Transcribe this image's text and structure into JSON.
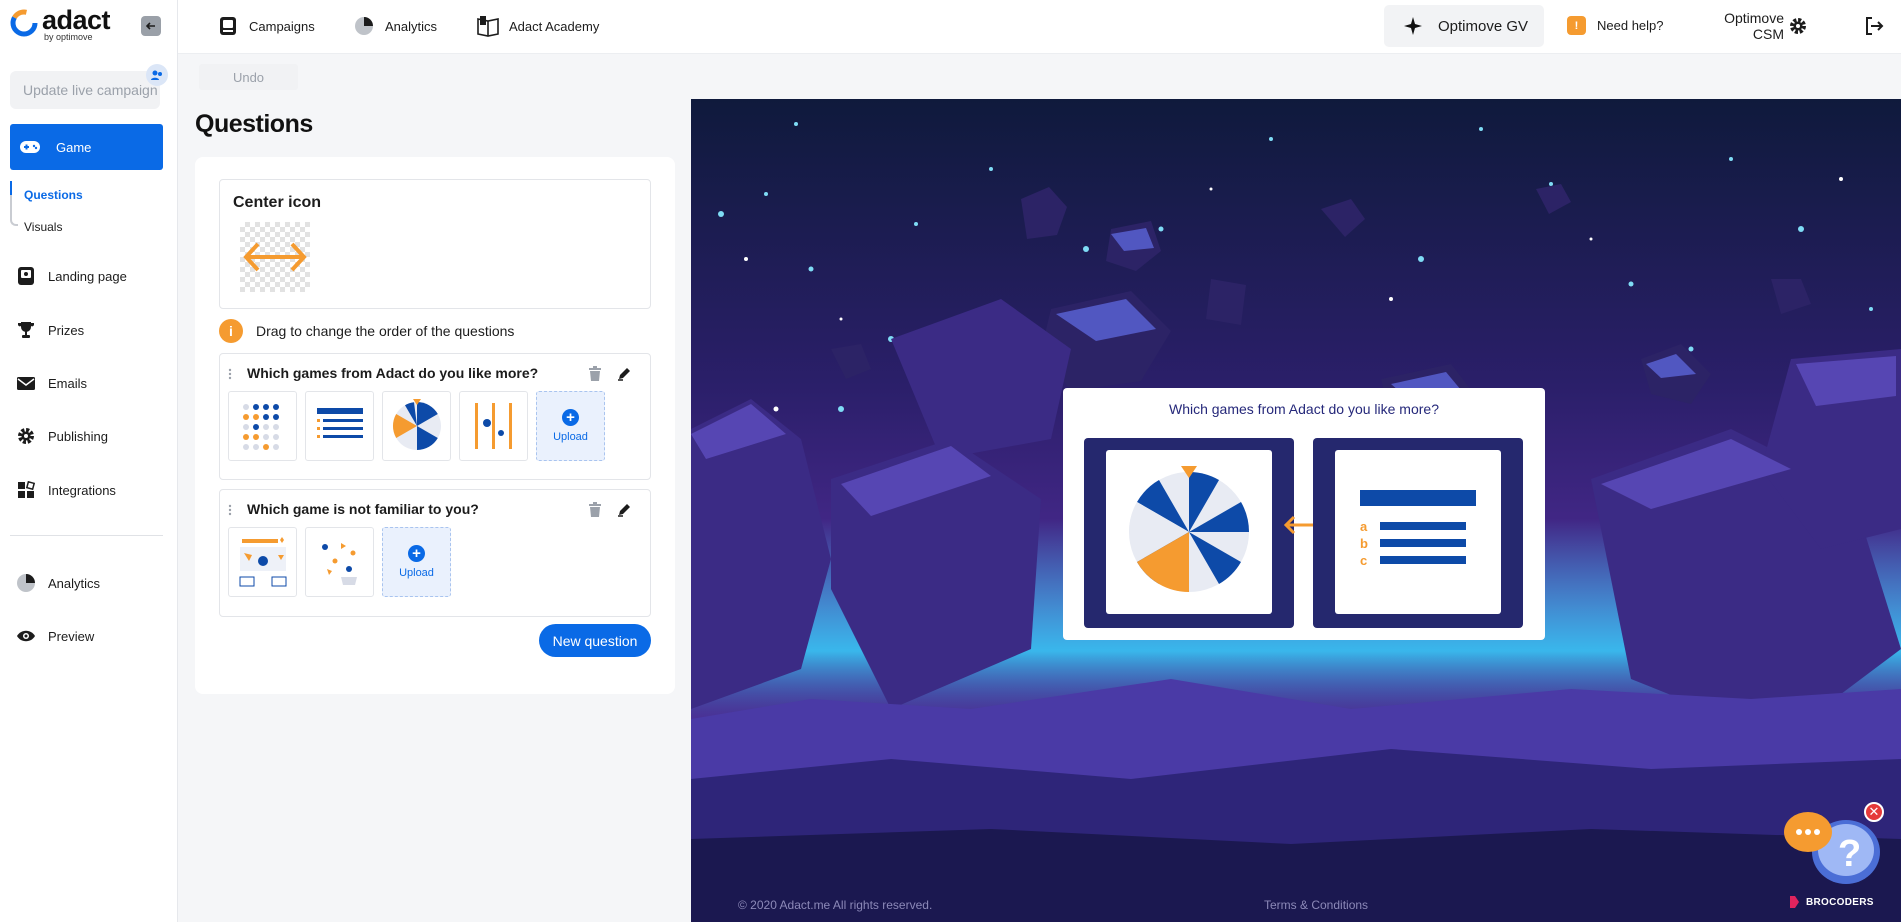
{
  "app": {
    "logo_word": "adact",
    "logo_sub": "by optimove"
  },
  "sidebar": {
    "update_campaign": "Update live campaign",
    "game_label": "Game",
    "sub_items": [
      "Questions",
      "Visuals"
    ],
    "items": [
      {
        "label": "Landing page",
        "icon": "page-icon"
      },
      {
        "label": "Prizes",
        "icon": "trophy-icon"
      },
      {
        "label": "Emails",
        "icon": "envelope-icon"
      },
      {
        "label": "Publishing",
        "icon": "gear-icon"
      },
      {
        "label": "Integrations",
        "icon": "grid-icon"
      }
    ],
    "bottom_items": [
      {
        "label": "Analytics",
        "icon": "pie-chart-icon"
      },
      {
        "label": "Preview",
        "icon": "eye-icon"
      }
    ]
  },
  "topbar": {
    "campaigns": "Campaigns",
    "analytics": "Analytics",
    "academy": "Adact Academy",
    "account": "Optimove GV",
    "help_badge": "!",
    "help": "Need help?",
    "user_line1": "Optimove",
    "user_line2": "CSM"
  },
  "editor": {
    "undo": "Undo",
    "title": "Questions",
    "center_icon_title": "Center icon",
    "hint": "Drag to change the order of the questions",
    "questions": [
      {
        "title": "Which games from Adact do you like more?"
      },
      {
        "title": "Which game is not familiar to you?"
      }
    ],
    "upload_label": "Upload",
    "new_question": "New question"
  },
  "preview": {
    "question": "Which games from Adact do you like more?",
    "option_b_letters": [
      "a",
      "b",
      "c"
    ],
    "footer_copyright": "© 2020 Adact.me All rights reserved.",
    "footer_terms": "Terms & Conditions",
    "footer_brand": "BROCODERS"
  },
  "colors": {
    "accent": "#0a6ae6",
    "warning": "#f59b30",
    "preview_navy": "#25286e"
  }
}
